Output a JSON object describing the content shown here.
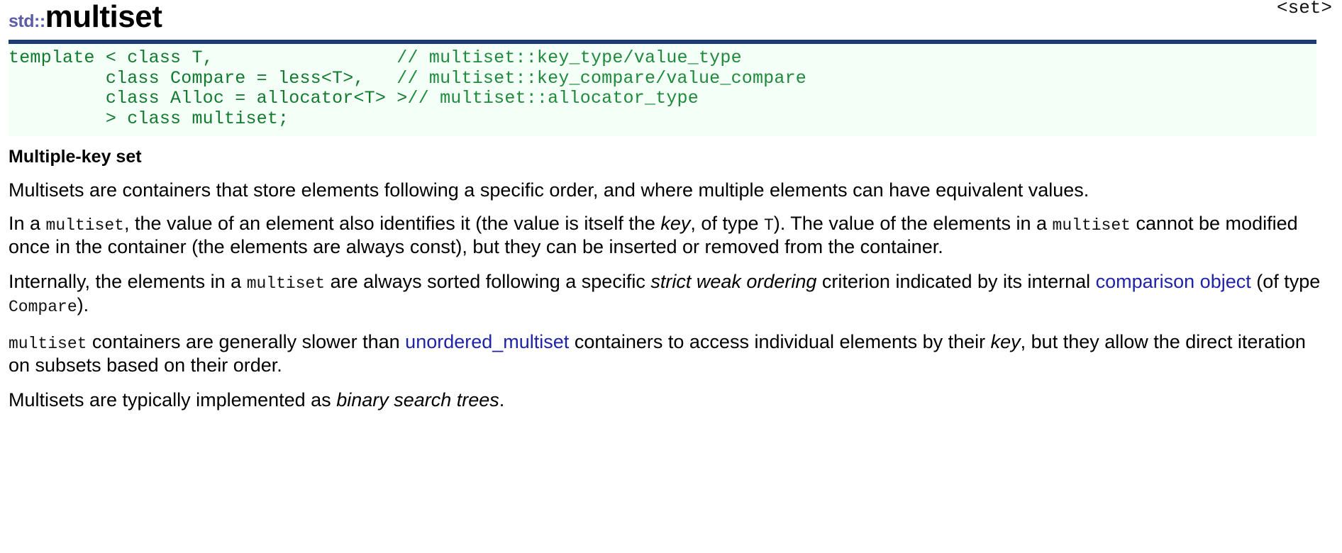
{
  "header": {
    "namespace": "std::",
    "class_name": "multiset",
    "header_file": "<set>"
  },
  "prototype": {
    "lines": [
      {
        "code": "template < class T,",
        "comment": "// multiset::key_type/value_type"
      },
      {
        "code": "         class Compare = less<T>,",
        "comment": "// multiset::key_compare/value_compare"
      },
      {
        "code": "         class Alloc = allocator<T> >",
        "comment": "// multiset::allocator_type"
      },
      {
        "code": "         > class multiset;",
        "comment": ""
      }
    ]
  },
  "content": {
    "subheading": "Multiple-key set",
    "p1": "Multisets are containers that store elements following a specific order, and where multiple elements can have equivalent values.",
    "p2": {
      "t1": "In a ",
      "c1": "multiset",
      "t2": ", the value of an element also identifies it (the value is itself the ",
      "i1": "key",
      "t3": ", of type ",
      "c2": "T",
      "t4": "). The value of the elements in a ",
      "c3": "multiset",
      "t5": " cannot be modified once in the container (the elements are always const), but they can be inserted or removed from the container."
    },
    "p3": {
      "t1": "Internally, the elements in a ",
      "c1": "multiset",
      "t2": " are always sorted following a specific ",
      "i1": "strict weak ordering",
      "t3": " criterion indicated by its internal ",
      "link1": "comparison object",
      "t4": " (of type ",
      "c2": "Compare",
      "t5": ")."
    },
    "p4": {
      "c1": "multiset",
      "t1": " containers are generally slower than ",
      "link1": "unordered_multiset",
      "t2": " containers to access individual elements by their ",
      "i1": "key",
      "t3": ", but they allow the direct iteration on subsets based on their order."
    },
    "p5": {
      "t1": "Multisets are typically implemented as ",
      "i1": "binary search trees",
      "t2": "."
    }
  },
  "colors": {
    "rule": "#1f3b73",
    "code_bg": "#f3fff7",
    "code_text": "#127a2e",
    "namespace": "#5b5ea6",
    "link": "#1f23a8"
  }
}
